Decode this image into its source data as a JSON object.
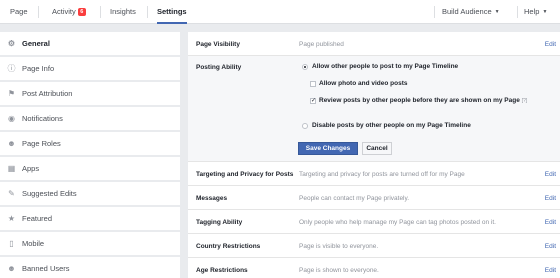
{
  "topbar": {
    "tabs": [
      {
        "label": "Page"
      },
      {
        "label": "Activity",
        "badge": "6"
      },
      {
        "label": "Insights"
      },
      {
        "label": "Settings"
      }
    ],
    "build_audience": "Build Audience",
    "help": "Help"
  },
  "sidebar": {
    "items": [
      {
        "label": "General",
        "icon": "gear-icon"
      },
      {
        "label": "Page Info",
        "icon": "info-icon"
      },
      {
        "label": "Post Attribution",
        "icon": "flag-icon"
      },
      {
        "label": "Notifications",
        "icon": "globe-icon"
      },
      {
        "label": "Page Roles",
        "icon": "person-icon"
      },
      {
        "label": "Apps",
        "icon": "apps-icon"
      },
      {
        "label": "Suggested Edits",
        "icon": "pencil-icon"
      },
      {
        "label": "Featured",
        "icon": "star-icon"
      },
      {
        "label": "Mobile",
        "icon": "mobile-icon"
      },
      {
        "label": "Banned Users",
        "icon": "person-icon"
      }
    ]
  },
  "settings": {
    "edit_label": "Edit",
    "page_visibility": {
      "label": "Page Visibility",
      "value": "Page published"
    },
    "posting_ability": {
      "label": "Posting Ability",
      "option_allow": "Allow other people to post to my Page Timeline",
      "option_photo": "Allow photo and video posts",
      "option_review": "Review posts by other people before they are shown on my Page",
      "option_review_help": "[?]",
      "option_disable": "Disable posts by other people on my Page Timeline",
      "photo_checked": false,
      "review_checked": true,
      "save_label": "Save Changes",
      "cancel_label": "Cancel"
    },
    "rows": [
      {
        "label": "Targeting and Privacy for Posts",
        "value": "Targeting and privacy for posts are turned off for my Page"
      },
      {
        "label": "Messages",
        "value": "People can contact my Page privately."
      },
      {
        "label": "Tagging Ability",
        "value": "Only people who help manage my Page can tag photos posted on it."
      },
      {
        "label": "Country Restrictions",
        "value": "Page is visible to everyone."
      },
      {
        "label": "Age Restrictions",
        "value": "Page is shown to everyone."
      }
    ]
  }
}
